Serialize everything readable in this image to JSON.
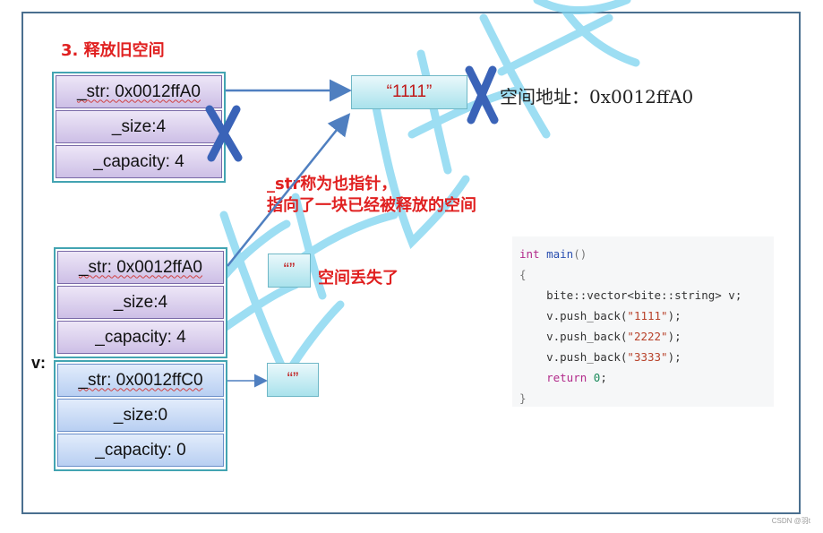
{
  "title": "3. 释放旧空间",
  "old_object": {
    "str": "_str: 0x0012ffA0",
    "size": "_size:4",
    "capacity": "_capacity: 4"
  },
  "old_string": "“1111”",
  "address_label": "空间地址：0x0012ffA0",
  "dangling_note": [
    "_str称为也指针，",
    "指向了一块已经被释放的空间"
  ],
  "middle_object": {
    "str": "_str: 0x0012ffA0",
    "size": "_size:4",
    "capacity": "_capacity: 4"
  },
  "middle_string": "“”",
  "lost_note": "空间丢失了",
  "v_label": "v:",
  "v_object": {
    "str": "_str: 0x0012ffC0",
    "size": "_size:0",
    "capacity": "_capacity: 0"
  },
  "v_string": "“”",
  "code": [
    {
      "parts": [
        [
          "kw",
          "int "
        ],
        [
          "fn",
          "main"
        ],
        [
          "pn",
          "()"
        ]
      ]
    },
    {
      "parts": [
        [
          "pn",
          "{"
        ]
      ]
    },
    {
      "parts": [
        [
          "",
          "    bite::vector<bite::string> v;"
        ]
      ]
    },
    {
      "parts": [
        [
          "",
          "    v.push_back("
        ],
        [
          "st",
          "\"1111\""
        ],
        [
          "",
          "); "
        ]
      ]
    },
    {
      "parts": [
        [
          "",
          "    v.push_back("
        ],
        [
          "st",
          "\"2222\""
        ],
        [
          "",
          "); "
        ]
      ]
    },
    {
      "parts": [
        [
          "",
          "    v.push_back("
        ],
        [
          "st",
          "\"3333\""
        ],
        [
          "",
          "); "
        ]
      ]
    },
    {
      "parts": [
        [
          "kw",
          "    return "
        ],
        [
          "nm",
          "0"
        ],
        [
          "",
          ";"
        ]
      ]
    },
    {
      "parts": [
        [
          "pn",
          "}"
        ]
      ]
    }
  ],
  "credit": "CSDN @羽t",
  "colors": {
    "accent_red": "#e02020",
    "arrow_blue": "#4f7fc0",
    "cross_blue": "#3a63b8",
    "watermark": "#7dd3f0"
  }
}
